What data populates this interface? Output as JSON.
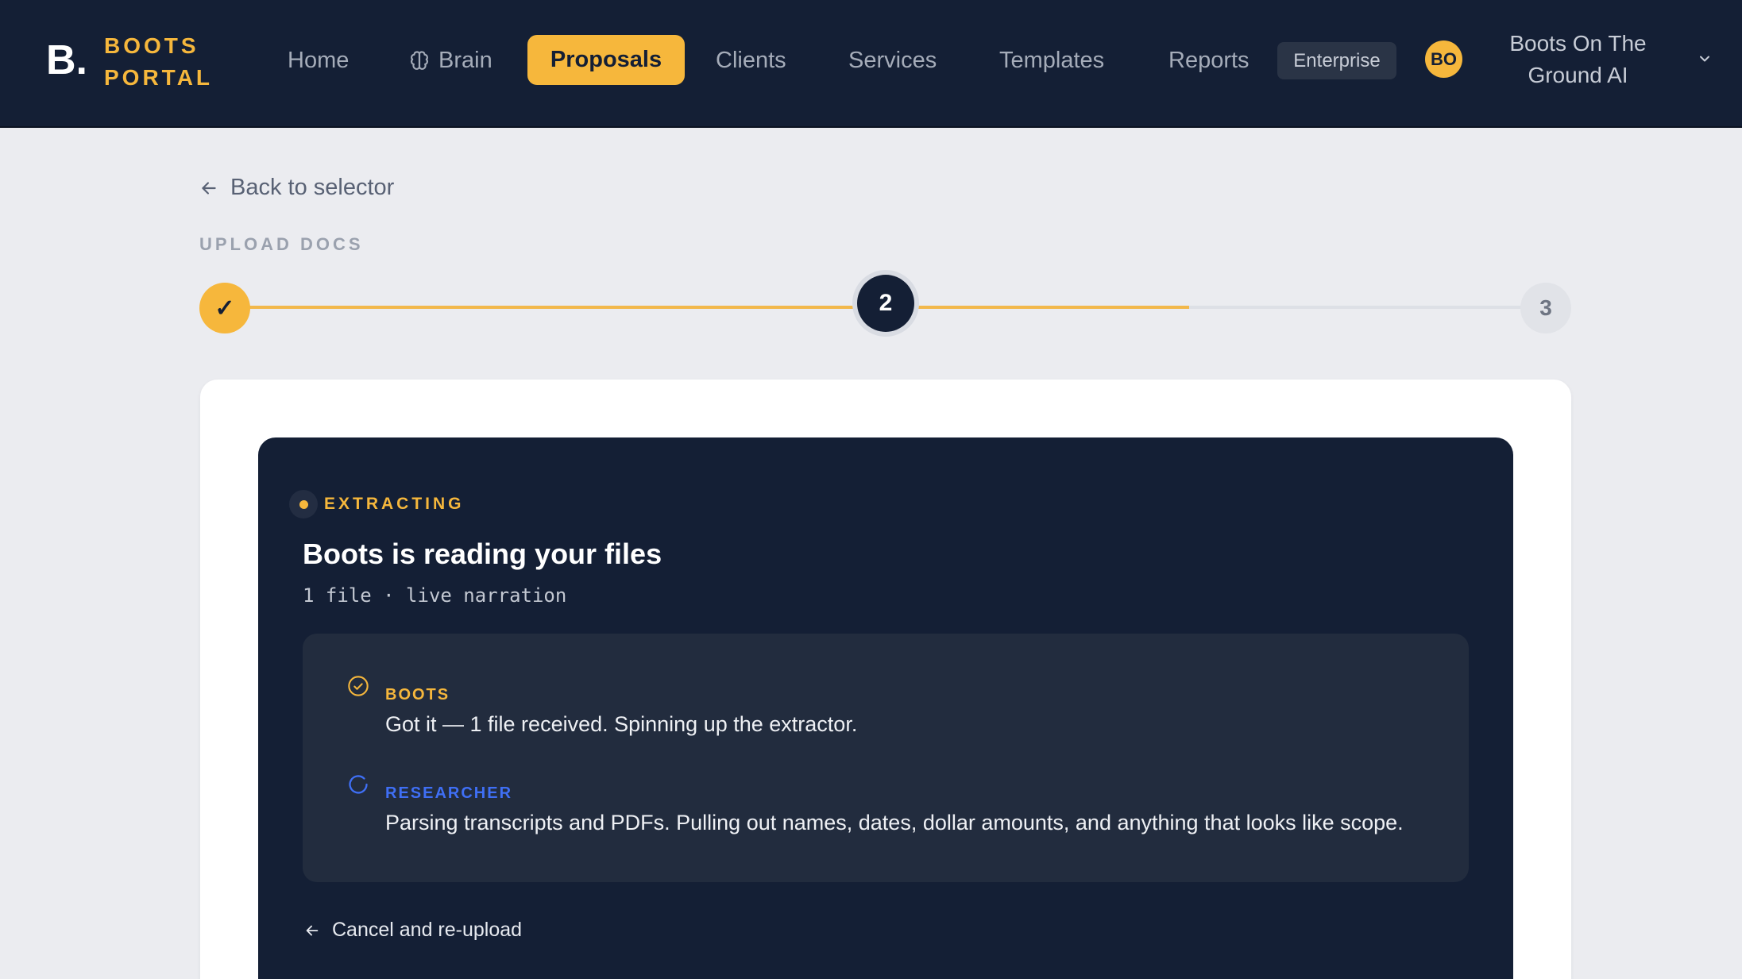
{
  "brand": {
    "mark": "B.",
    "name_line1": "BOOTS",
    "name_line2": "PORTAL",
    "accent": "#f6b73c",
    "nav_bg": "#141f35"
  },
  "nav": {
    "items": [
      {
        "label": "Home"
      },
      {
        "label": "Brain",
        "icon": "brain-icon"
      },
      {
        "label": "Proposals",
        "active": true
      },
      {
        "label": "Clients"
      },
      {
        "label": "Services"
      },
      {
        "label": "Templates"
      },
      {
        "label": "Reports"
      }
    ],
    "plan_badge": "Enterprise",
    "avatar_initials": "BO",
    "org_name_line1": "Boots On The",
    "org_name_line2": "Ground AI",
    "org_menu_icon": "chevron-down-icon"
  },
  "page": {
    "back_label": "Back to selector",
    "back_icon": "arrow-left-icon",
    "section_label": "UPLOAD DOCS"
  },
  "stepper": {
    "steps": [
      {
        "label": "✓",
        "state": "complete"
      },
      {
        "label": "2",
        "state": "current"
      },
      {
        "label": "3",
        "state": "upcoming"
      }
    ],
    "progress_fraction": 0.73
  },
  "extraction": {
    "status": "EXTRACTING",
    "title": "Boots is reading your files",
    "subtitle": "1 file · live narration",
    "log": [
      {
        "role": "BOOTS",
        "icon": "check-circle-icon",
        "message": "Got it — 1 file received. Spinning up the extractor."
      },
      {
        "role": "RESEARCHER",
        "icon": "spinner-icon",
        "message": "Parsing transcripts and PDFs. Pulling out names, dates, dollar amounts, and anything that looks like scope."
      }
    ],
    "cancel_label": "Cancel and re-upload",
    "cancel_icon": "arrow-left-icon"
  }
}
